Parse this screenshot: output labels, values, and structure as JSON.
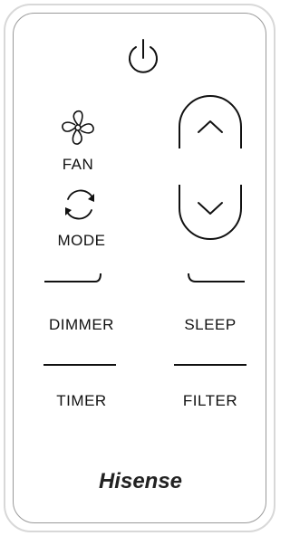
{
  "remote": {
    "buttons": {
      "power": {
        "icon": "power-icon"
      },
      "fan": {
        "label": "FAN",
        "icon": "fan-icon"
      },
      "mode": {
        "label": "MODE",
        "icon": "mode-cycle-icon"
      },
      "up": {
        "icon": "chevron-up-icon"
      },
      "down": {
        "icon": "chevron-down-icon"
      },
      "dimmer": {
        "label": "DIMMER"
      },
      "sleep": {
        "label": "SLEEP"
      },
      "timer": {
        "label": "TIMER"
      },
      "filter": {
        "label": "FILTER"
      }
    },
    "brand": "Hisense",
    "colors": {
      "ink": "#111111",
      "body": "#ffffff",
      "outline": "#9a9a9a"
    }
  }
}
